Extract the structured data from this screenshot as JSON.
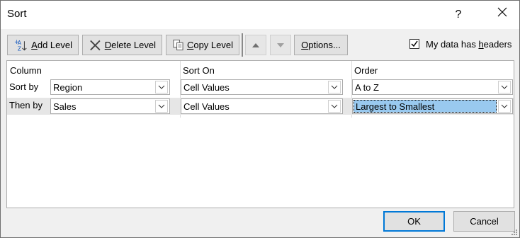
{
  "window": {
    "title": "Sort",
    "help_glyph": "?",
    "close_glyph": "✕"
  },
  "toolbar": {
    "add_level": {
      "hotkey": "A",
      "rest": "dd Level"
    },
    "delete_level": {
      "hotkey": "D",
      "rest": "elete Level"
    },
    "copy_level": {
      "hotkey": "C",
      "rest": "opy Level"
    },
    "options": {
      "hotkey": "O",
      "rest": "ptions..."
    },
    "headers_checkbox": {
      "checked": true,
      "label_pre": "My data has ",
      "hotkey": "h",
      "label_post": "eaders"
    }
  },
  "grid": {
    "headers": {
      "column": "Column",
      "sort_on": "Sort On",
      "order": "Order"
    },
    "rows": [
      {
        "label": "Sort by",
        "column": "Region",
        "sort_on": "Cell Values",
        "order": "A to Z"
      },
      {
        "label": "Then by",
        "column": "Sales",
        "sort_on": "Cell Values",
        "order": "Largest to Smallest"
      }
    ]
  },
  "footer": {
    "ok": "OK",
    "cancel": "Cancel"
  },
  "colors": {
    "accent": "#0078d7",
    "selection": "#99c9ef"
  }
}
